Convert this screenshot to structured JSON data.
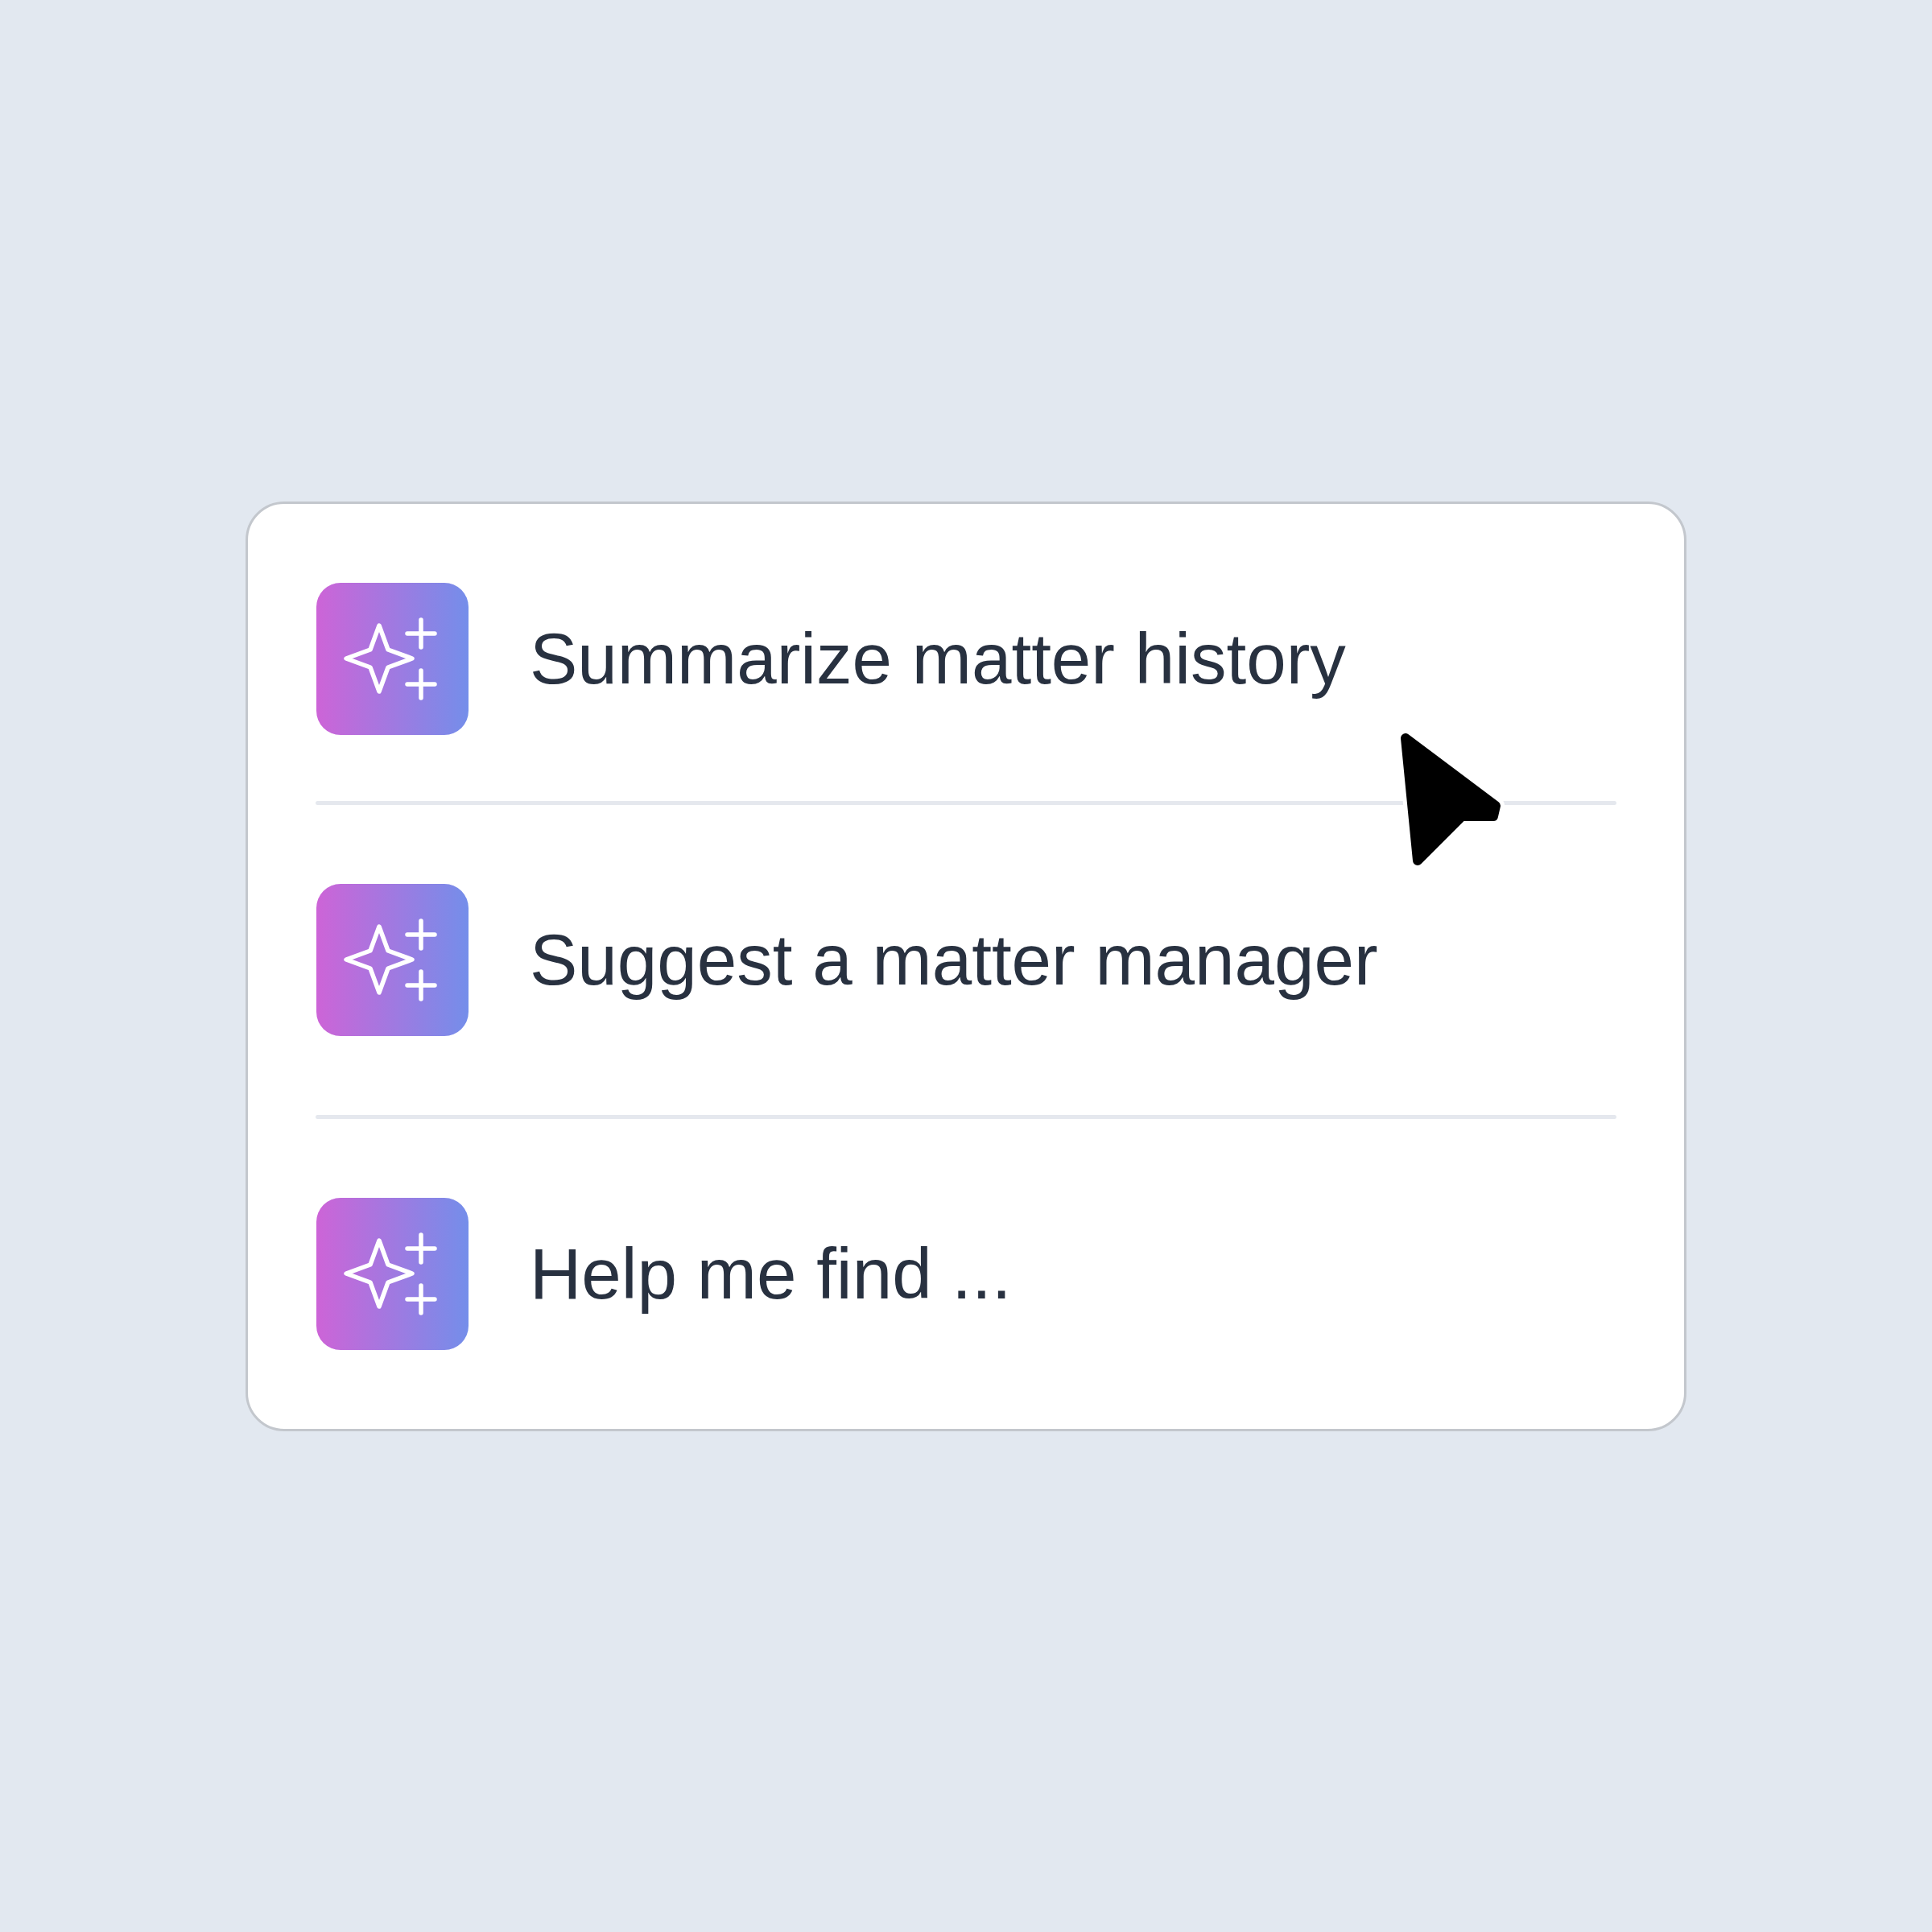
{
  "suggestions": [
    {
      "label": "Summarize matter history"
    },
    {
      "label": "Suggest a matter manager"
    },
    {
      "label": "Help me find ..."
    }
  ]
}
